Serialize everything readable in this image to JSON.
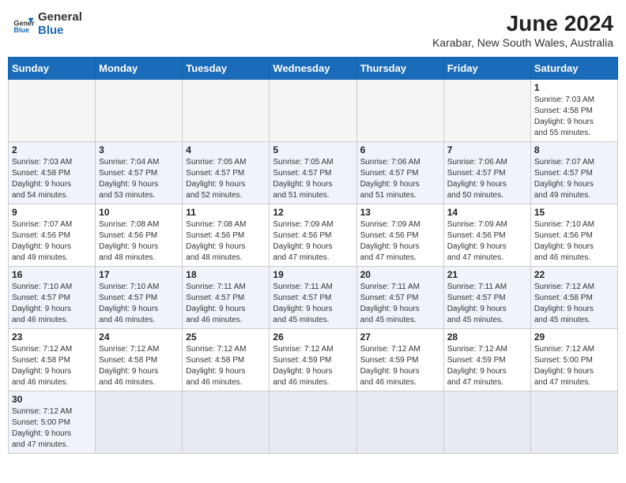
{
  "header": {
    "logo_general": "General",
    "logo_blue": "Blue",
    "month_title": "June 2024",
    "location": "Karabar, New South Wales, Australia"
  },
  "weekdays": [
    "Sunday",
    "Monday",
    "Tuesday",
    "Wednesday",
    "Thursday",
    "Friday",
    "Saturday"
  ],
  "weeks": [
    [
      {
        "day": "",
        "info": ""
      },
      {
        "day": "",
        "info": ""
      },
      {
        "day": "",
        "info": ""
      },
      {
        "day": "",
        "info": ""
      },
      {
        "day": "",
        "info": ""
      },
      {
        "day": "",
        "info": ""
      },
      {
        "day": "1",
        "info": "Sunrise: 7:03 AM\nSunset: 4:58 PM\nDaylight: 9 hours\nand 55 minutes."
      }
    ],
    [
      {
        "day": "2",
        "info": "Sunrise: 7:03 AM\nSunset: 4:58 PM\nDaylight: 9 hours\nand 54 minutes."
      },
      {
        "day": "3",
        "info": "Sunrise: 7:04 AM\nSunset: 4:57 PM\nDaylight: 9 hours\nand 53 minutes."
      },
      {
        "day": "4",
        "info": "Sunrise: 7:05 AM\nSunset: 4:57 PM\nDaylight: 9 hours\nand 52 minutes."
      },
      {
        "day": "5",
        "info": "Sunrise: 7:05 AM\nSunset: 4:57 PM\nDaylight: 9 hours\nand 51 minutes."
      },
      {
        "day": "6",
        "info": "Sunrise: 7:06 AM\nSunset: 4:57 PM\nDaylight: 9 hours\nand 51 minutes."
      },
      {
        "day": "7",
        "info": "Sunrise: 7:06 AM\nSunset: 4:57 PM\nDaylight: 9 hours\nand 50 minutes."
      },
      {
        "day": "8",
        "info": "Sunrise: 7:07 AM\nSunset: 4:57 PM\nDaylight: 9 hours\nand 49 minutes."
      }
    ],
    [
      {
        "day": "9",
        "info": "Sunrise: 7:07 AM\nSunset: 4:56 PM\nDaylight: 9 hours\nand 49 minutes."
      },
      {
        "day": "10",
        "info": "Sunrise: 7:08 AM\nSunset: 4:56 PM\nDaylight: 9 hours\nand 48 minutes."
      },
      {
        "day": "11",
        "info": "Sunrise: 7:08 AM\nSunset: 4:56 PM\nDaylight: 9 hours\nand 48 minutes."
      },
      {
        "day": "12",
        "info": "Sunrise: 7:09 AM\nSunset: 4:56 PM\nDaylight: 9 hours\nand 47 minutes."
      },
      {
        "day": "13",
        "info": "Sunrise: 7:09 AM\nSunset: 4:56 PM\nDaylight: 9 hours\nand 47 minutes."
      },
      {
        "day": "14",
        "info": "Sunrise: 7:09 AM\nSunset: 4:56 PM\nDaylight: 9 hours\nand 47 minutes."
      },
      {
        "day": "15",
        "info": "Sunrise: 7:10 AM\nSunset: 4:56 PM\nDaylight: 9 hours\nand 46 minutes."
      }
    ],
    [
      {
        "day": "16",
        "info": "Sunrise: 7:10 AM\nSunset: 4:57 PM\nDaylight: 9 hours\nand 46 minutes."
      },
      {
        "day": "17",
        "info": "Sunrise: 7:10 AM\nSunset: 4:57 PM\nDaylight: 9 hours\nand 46 minutes."
      },
      {
        "day": "18",
        "info": "Sunrise: 7:11 AM\nSunset: 4:57 PM\nDaylight: 9 hours\nand 46 minutes."
      },
      {
        "day": "19",
        "info": "Sunrise: 7:11 AM\nSunset: 4:57 PM\nDaylight: 9 hours\nand 45 minutes."
      },
      {
        "day": "20",
        "info": "Sunrise: 7:11 AM\nSunset: 4:57 PM\nDaylight: 9 hours\nand 45 minutes."
      },
      {
        "day": "21",
        "info": "Sunrise: 7:11 AM\nSunset: 4:57 PM\nDaylight: 9 hours\nand 45 minutes."
      },
      {
        "day": "22",
        "info": "Sunrise: 7:12 AM\nSunset: 4:58 PM\nDaylight: 9 hours\nand 45 minutes."
      }
    ],
    [
      {
        "day": "23",
        "info": "Sunrise: 7:12 AM\nSunset: 4:58 PM\nDaylight: 9 hours\nand 46 minutes."
      },
      {
        "day": "24",
        "info": "Sunrise: 7:12 AM\nSunset: 4:58 PM\nDaylight: 9 hours\nand 46 minutes."
      },
      {
        "day": "25",
        "info": "Sunrise: 7:12 AM\nSunset: 4:58 PM\nDaylight: 9 hours\nand 46 minutes."
      },
      {
        "day": "26",
        "info": "Sunrise: 7:12 AM\nSunset: 4:59 PM\nDaylight: 9 hours\nand 46 minutes."
      },
      {
        "day": "27",
        "info": "Sunrise: 7:12 AM\nSunset: 4:59 PM\nDaylight: 9 hours\nand 46 minutes."
      },
      {
        "day": "28",
        "info": "Sunrise: 7:12 AM\nSunset: 4:59 PM\nDaylight: 9 hours\nand 47 minutes."
      },
      {
        "day": "29",
        "info": "Sunrise: 7:12 AM\nSunset: 5:00 PM\nDaylight: 9 hours\nand 47 minutes."
      }
    ],
    [
      {
        "day": "30",
        "info": "Sunrise: 7:12 AM\nSunset: 5:00 PM\nDaylight: 9 hours\nand 47 minutes."
      },
      {
        "day": "",
        "info": ""
      },
      {
        "day": "",
        "info": ""
      },
      {
        "day": "",
        "info": ""
      },
      {
        "day": "",
        "info": ""
      },
      {
        "day": "",
        "info": ""
      },
      {
        "day": "",
        "info": ""
      }
    ]
  ]
}
